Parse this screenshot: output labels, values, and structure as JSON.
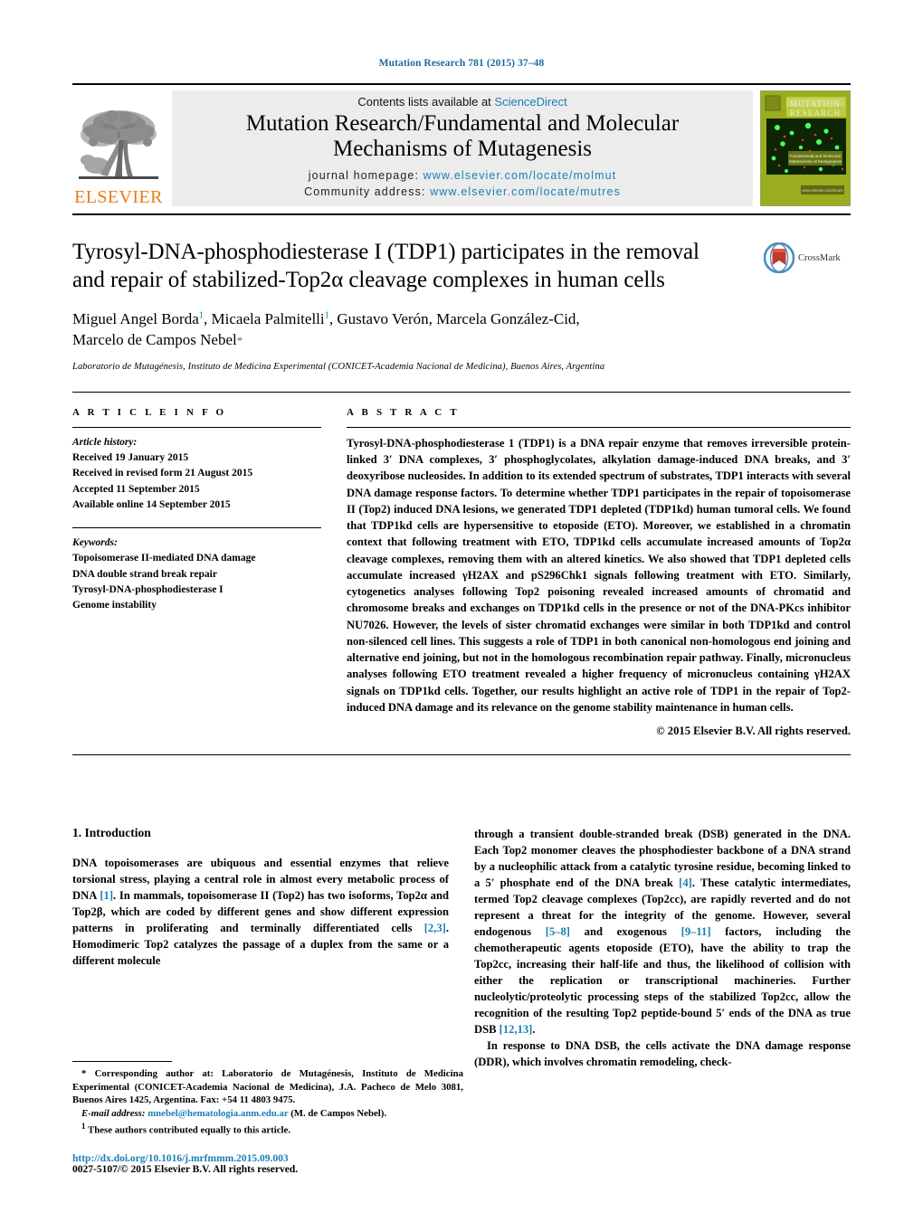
{
  "running_head": "Mutation Research 781 (2015) 37–48",
  "masthead": {
    "contents_prefix": "Contents lists available at ",
    "sciencedirect": "ScienceDirect",
    "journal_title_line1": "Mutation Research/Fundamental and Molecular",
    "journal_title_line2": "Mechanisms of Mutagenesis",
    "homepage_label": "journal homepage:",
    "homepage_url": "www.elsevier.com/locate/molmut",
    "community_label": "Community address:",
    "community_url": "www.elsevier.com/locate/mutres",
    "publisher_wordmark": "ELSEVIER",
    "cover": {
      "title_line1": "MUTATION",
      "title_line2": "RESEARCH",
      "subtitle_line1": "Fundamental and Molecular",
      "subtitle_line2": "Mechanisms of Mutagenesis",
      "footer": "www.elsevier.com/locate",
      "background_color": "#9aad1f",
      "panel_color": "#0d2405"
    }
  },
  "article": {
    "title_line1": "Tyrosyl-DNA-phosphodiesterase I (TDP1) participates in the removal",
    "title_line2": "and repair of stabilized-Top2α cleavage complexes in human cells",
    "authors_line1": "Miguel Angel Borda",
    "authors_line1b": ", Micaela Palmitelli",
    "authors_line1c": ", Gustavo Verón, Marcela González-Cid,",
    "authors_line2": "Marcelo de Campos Nebel",
    "author_marker_1": "1",
    "author_marker_corresponding": "*",
    "affiliation": "Laboratorio de Mutagénesis, Instituto de Medicina Experimental (CONICET-Academia Nacional de Medicina), Buenos Aires, Argentina",
    "crossmark_label": "CrossMark"
  },
  "article_info": {
    "heading": "A R T I C L E   I N F O",
    "history_label": "Article history:",
    "history": [
      "Received 19 January 2015",
      "Received in revised form 21 August 2015",
      "Accepted 11 September 2015",
      "Available online 14 September 2015"
    ],
    "keywords_label": "Keywords:",
    "keywords": [
      "Topoisomerase II-mediated DNA damage",
      "DNA double strand break repair",
      "Tyrosyl-DNA-phosphodiesterase I",
      "Genome instability"
    ]
  },
  "abstract": {
    "heading": "A B S T R A C T",
    "text": "Tyrosyl-DNA-phosphodiesterase 1 (TDP1) is a DNA repair enzyme that removes irreversible protein-linked 3′ DNA complexes, 3′ phosphoglycolates, alkylation damage-induced DNA breaks, and 3′ deoxyribose nucleosides. In addition to its extended spectrum of substrates, TDP1 interacts with several DNA damage response factors. To determine whether TDP1 participates in the repair of topoisomerase II (Top2) induced DNA lesions, we generated TDP1 depleted (TDP1kd) human tumoral cells. We found that TDP1kd cells are hypersensitive to etoposide (ETO). Moreover, we established in a chromatin context that following treatment with ETO, TDP1kd cells accumulate increased amounts of Top2α cleavage complexes, removing them with an altered kinetics. We also showed that TDP1 depleted cells accumulate increased γH2AX and pS296Chk1 signals following treatment with ETO. Similarly, cytogenetics analyses following Top2 poisoning revealed increased amounts of chromatid and chromosome breaks and exchanges on TDP1kd cells in the presence or not of the DNA-PKcs inhibitor NU7026. However, the levels of sister chromatid exchanges were similar in both TDP1kd and control non-silenced cell lines. This suggests a role of TDP1 in both canonical non-homologous end joining and alternative end joining, but not in the homologous recombination repair pathway. Finally, micronucleus analyses following ETO treatment revealed a higher frequency of micronucleus containing γH2AX signals on TDP1kd cells. Together, our results highlight an active role of TDP1 in the repair of Top2-induced DNA damage and its relevance on the genome stability maintenance in human cells.",
    "copyright": "© 2015 Elsevier B.V. All rights reserved."
  },
  "introduction": {
    "section_number_title": "1.  Introduction",
    "left_paragraph_part1": "DNA topoisomerases are ubiquous and essential enzymes that relieve torsional stress, playing a central role in almost every metabolic process of DNA ",
    "ref_1": "[1]",
    "left_paragraph_part2": ". In mammals, topoisomerase II (Top2) has two isoforms, Top2α and Top2β, which are coded by different genes and show different expression patterns in proliferating and terminally differentiated cells ",
    "ref_23": "[2,3]",
    "left_paragraph_part3": ". Homodimeric Top2 catalyzes the passage of a duplex from the same or a different molecule",
    "right_paragraph_part1": "through a transient double-stranded break (DSB) generated in the DNA. Each Top2 monomer cleaves the phosphodiester backbone of a DNA strand by a nucleophilic attack from a catalytic tyrosine residue, becoming linked to a 5′ phosphate end of the DNA break ",
    "ref_4": "[4]",
    "right_paragraph_part2": ". These catalytic intermediates, termed Top2 cleavage complexes (Top2cc), are rapidly reverted and do not represent a threat for the integrity of the genome. However, several endogenous ",
    "ref_58": "[5–8]",
    "right_paragraph_part3": " and exogenous ",
    "ref_911": "[9–11]",
    "right_paragraph_part4": " factors, including the chemotherapeutic agents etoposide (ETO), have the ability to trap the Top2cc, increasing their half-life and thus, the likelihood of collision with either the replication or transcriptional machineries. Further nucleolytic/proteolytic processing steps of the stabilized Top2cc, allow the recognition of the resulting Top2 peptide-bound 5′ ends of the DNA as true DSB ",
    "ref_1213": "[12,13]",
    "right_paragraph_part5": ".",
    "right_paragraph2": "In response to DNA DSB, the cells activate the DNA damage response (DDR), which involves chromatin remodeling, check-"
  },
  "footnotes": {
    "corresponding_marker": "*",
    "corresponding_text": " Corresponding author at: Laboratorio de Mutagénesis, Instituto de Medicina Experimental (CONICET-Academia Nacional de Medicina), J.A. Pacheco de Melo 3081, Buenos Aires 1425, Argentina. Fax: +54 11 4803 9475.",
    "email_label": "E-mail address:",
    "email_address": "mnebel@hematologia.anm.edu.ar",
    "email_suffix": " (M. de Campos Nebel).",
    "equal_contribution_marker": "1",
    "equal_contribution_text": " These authors contributed equally to this article.",
    "doi_url": "http://dx.doi.org/10.1016/j.mrfmmm.2015.09.003",
    "issn_copyright": "0027-5107/© 2015 Elsevier B.V. All rights reserved."
  },
  "colors": {
    "link_blue": "#1a7fb5",
    "elsevier_orange": "#ee7918",
    "running_head_blue": "#1a6b9c"
  }
}
